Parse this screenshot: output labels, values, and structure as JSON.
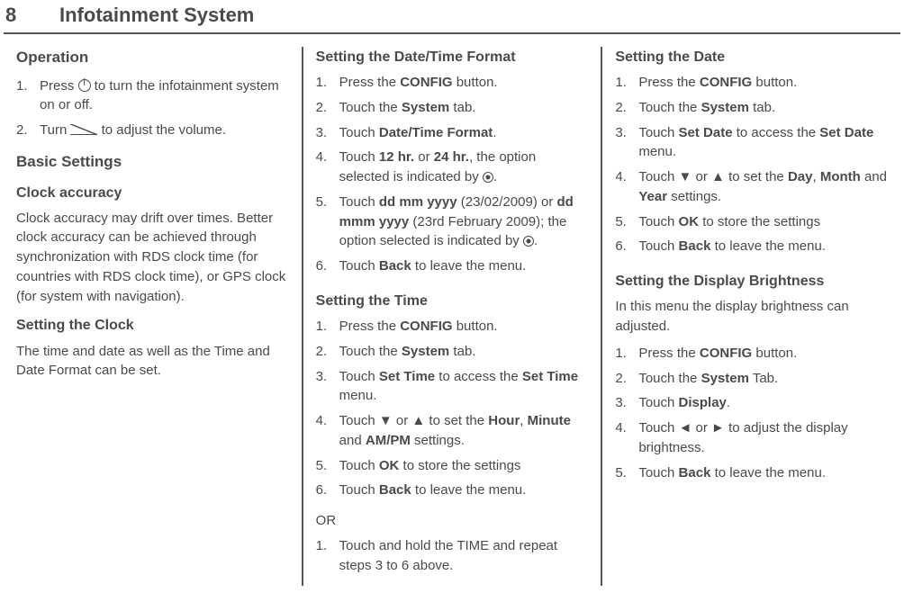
{
  "page_number": "8",
  "page_title": "Infotainment System",
  "col1": {
    "operation_heading": "Operation",
    "op_steps": {
      "n1": "1.",
      "s1a": "Press ",
      "s1b": " to turn the infotainment system on or off.",
      "n2": "2.",
      "s2a": "Turn ",
      "s2b": "  to adjust the volume."
    },
    "basic_settings_heading": "Basic Settings",
    "clock_accuracy_heading": "Clock accuracy",
    "clock_accuracy_para": "Clock accuracy may drift over times. Better clock accuracy can be achieved through synchronization with RDS clock time (for countries with RDS clock time), or GPS clock (for system with navigation).",
    "setting_clock_heading": "Setting the Clock",
    "setting_clock_para": "The time and date as well as the Time and Date Format can be set."
  },
  "col2": {
    "dtf_heading": "Setting the Date/Time Format",
    "dtf": {
      "n1": "1.",
      "s1a": "Press the ",
      "s1b": "CONFIG",
      "s1c": " button.",
      "n2": "2.",
      "s2a": "Touch the ",
      "s2b": "System",
      "s2c": " tab.",
      "n3": "3.",
      "s3a": "Touch ",
      "s3b": "Date/Time Format",
      "s3c": ".",
      "n4": "4.",
      "s4a": "Touch ",
      "s4b": "12 hr.",
      "s4c": " or ",
      "s4d": "24 hr.",
      "s4e": ", the option selected is indicated by ",
      "s4f": ".",
      "n5": "5.",
      "s5a": "Touch ",
      "s5b": "dd mm yyyy",
      "s5c": " (23/02/2009) or ",
      "s5d": "dd mmm yyyy",
      "s5e": " (23rd February 2009); the option selected is indicated by ",
      "s5f": ".",
      "n6": "6.",
      "s6a": "Touch ",
      "s6b": "Back",
      "s6c": " to leave the menu."
    },
    "time_heading": "Setting the Time",
    "time": {
      "n1": "1.",
      "s1a": "Press the ",
      "s1b": "CONFIG",
      "s1c": " button.",
      "n2": "2.",
      "s2a": "Touch the ",
      "s2b": "System",
      "s2c": " tab.",
      "n3": "3.",
      "s3a": "Touch ",
      "s3b": "Set Time",
      "s3c": " to access the ",
      "s3d": "Set Time",
      "s3e": " menu.",
      "n4": "4.",
      "s4a": "Touch ▼ or ▲ to set the ",
      "s4b": "Hour",
      "s4c": ", ",
      "s4d": "Minute",
      "s4e": " and ",
      "s4f": "AM/PM",
      "s4g": " settings.",
      "n5": "5.",
      "s5a": "Touch ",
      "s5b": "OK",
      "s5c": " to store the settings",
      "n6": "6.",
      "s6a": "Touch ",
      "s6b": "Back",
      "s6c": "  to leave the menu."
    },
    "or_label": "OR",
    "time_alt": {
      "n1": "1.",
      "s1": "Touch and hold the TIME and repeat steps 3 to 6 above."
    }
  },
  "col3": {
    "date_heading": "Setting the Date",
    "date": {
      "n1": "1.",
      "s1a": "Press the ",
      "s1b": "CONFIG",
      "s1c": " button.",
      "n2": "2.",
      "s2a": "Touch the ",
      "s2b": "System",
      "s2c": " tab.",
      "n3": "3.",
      "s3a": "Touch ",
      "s3b": "Set Date",
      "s3c": " to access the ",
      "s3d": "Set Date",
      "s3e": " menu.",
      "n4": "4.",
      "s4a": "Touch ▼ or ▲ to set the ",
      "s4b": "Day",
      "s4c": ", ",
      "s4d": "Month",
      "s4e": " and ",
      "s4f": "Year",
      "s4g": " settings.",
      "n5": "5.",
      "s5a": "Touch ",
      "s5b": "OK",
      "s5c": " to store the settings",
      "n6": "6.",
      "s6a": "Touch ",
      "s6b": "Back",
      "s6c": "  to leave the menu."
    },
    "bright_heading": "Setting the Display Brightness",
    "bright_intro": "In this menu the display brightness can adjusted.",
    "bright": {
      "n1": "1.",
      "s1a": "Press the ",
      "s1b": "CONFIG",
      "s1c": " button.",
      "n2": "2.",
      "s2a": "Touch the ",
      "s2b": "System",
      "s2c": " Tab.",
      "n3": "3.",
      "s3a": "Touch ",
      "s3b": "Display",
      "s3c": ".",
      "n4": "4.",
      "s4a": "Touch ◄ or ► to adjust the display brightness.",
      "n5": "5.",
      "s5a": "Touch ",
      "s5b": "Back",
      "s5c": " to leave the menu."
    }
  }
}
